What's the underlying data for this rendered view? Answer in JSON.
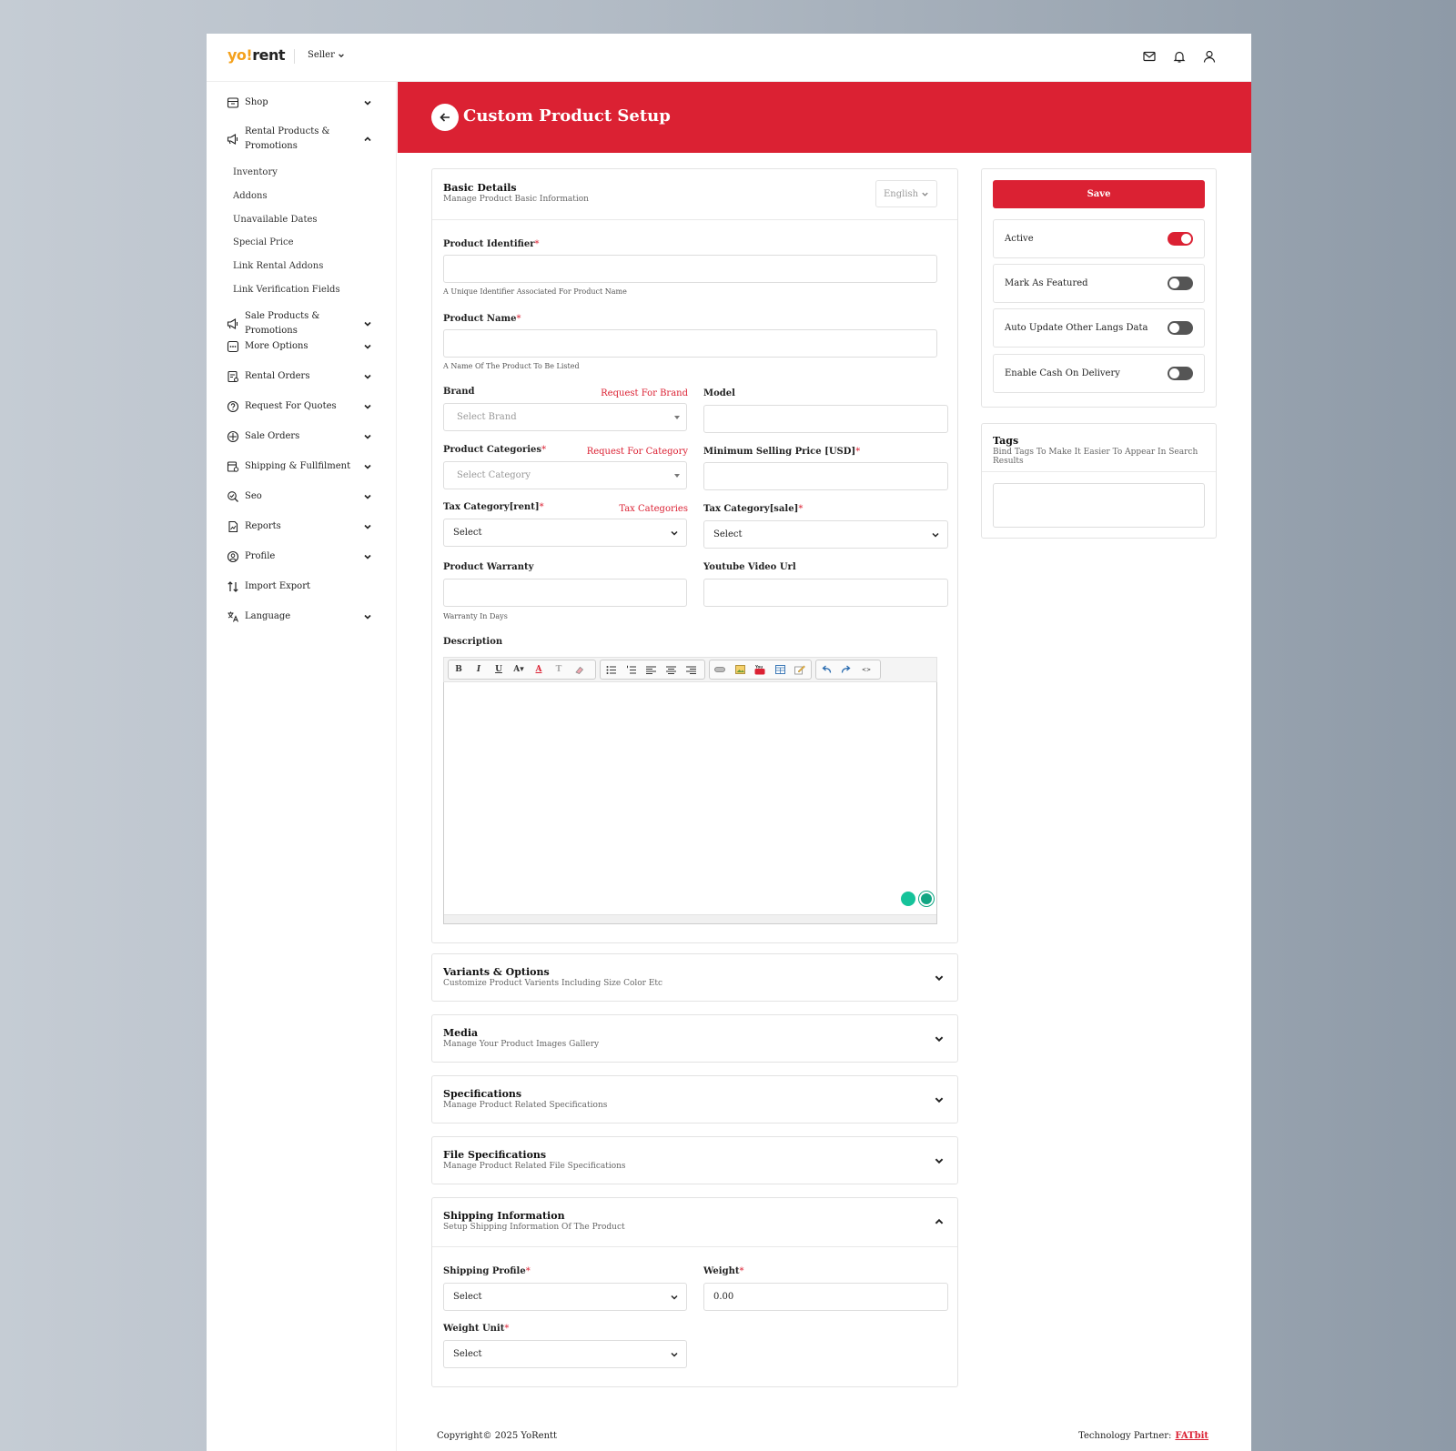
{
  "header": {
    "logo_prefix": "yo!",
    "logo_suffix": "rent",
    "role": "Seller"
  },
  "sidebar": {
    "items": [
      {
        "label": "Shop",
        "icon": "shop-icon"
      },
      {
        "label": "Rental Products & Promotions",
        "icon": "megaphone-icon"
      },
      {
        "label": "Sale Products & Promotions",
        "icon": "megaphone-icon"
      },
      {
        "label": "More Options",
        "icon": "more-icon"
      },
      {
        "label": "Rental Orders",
        "icon": "orders-icon"
      },
      {
        "label": "Request For Quotes",
        "icon": "question-icon"
      },
      {
        "label": "Sale Orders",
        "icon": "sale-icon"
      },
      {
        "label": "Shipping & Fullfilment",
        "icon": "shipping-icon"
      },
      {
        "label": "Seo",
        "icon": "seo-icon"
      },
      {
        "label": "Reports",
        "icon": "reports-icon"
      },
      {
        "label": "Profile",
        "icon": "profile-icon"
      },
      {
        "label": "Import Export",
        "icon": "import-export-icon"
      },
      {
        "label": "Language",
        "icon": "language-icon"
      }
    ],
    "sub_items": [
      "Inventory",
      "Addons",
      "Unavailable Dates",
      "Special Price",
      "Link Rental Addons",
      "Link Verification Fields"
    ]
  },
  "page": {
    "title": "Custom Product Setup"
  },
  "basic": {
    "title": "Basic Details",
    "subtitle": "Manage Product Basic Information",
    "language": "English",
    "product_identifier_label": "Product Identifier",
    "product_identifier_hint": "A Unique Identifier Associated For Product Name",
    "product_name_label": "Product Name",
    "product_name_hint": "A Name Of The Product To Be Listed",
    "brand_label": "Brand",
    "brand_link": "Request For Brand",
    "brand_placeholder": "Select Brand",
    "model_label": "Model",
    "categories_label": "Product Categories",
    "categories_link": "Request For Category",
    "categories_placeholder": "Select Category",
    "min_price_label": "Minimum Selling Price [USD]",
    "tax_rent_label": "Tax Category[rent]",
    "tax_link": "Tax Categories",
    "tax_rent_value": "Select",
    "tax_sale_label": "Tax Category[sale]",
    "tax_sale_value": "Select",
    "warranty_label": "Product Warranty",
    "warranty_hint": "Warranty In Days",
    "youtube_label": "Youtube Video Url",
    "description_label": "Description",
    "req_mark": "*"
  },
  "sections": [
    {
      "title": "Variants & Options",
      "subtitle": "Customize Product Varients Including Size Color Etc"
    },
    {
      "title": "Media",
      "subtitle": "Manage Your Product Images Gallery"
    },
    {
      "title": "Specifications",
      "subtitle": "Manage Product Related Specifications"
    },
    {
      "title": "File Specifications",
      "subtitle": "Manage Product Related File Specifications"
    }
  ],
  "shipping": {
    "title": "Shipping Information",
    "subtitle": "Setup Shipping Information Of The Product",
    "profile_label": "Shipping Profile",
    "profile_value": "Select",
    "weight_label": "Weight",
    "weight_value": "0.00",
    "unit_label": "Weight Unit",
    "unit_value": "Select"
  },
  "side": {
    "save_label": "Save",
    "toggles": [
      {
        "label": "Active",
        "on": true
      },
      {
        "label": "Mark As Featured",
        "on": false
      },
      {
        "label": "Auto Update Other Langs Data",
        "on": false
      },
      {
        "label": "Enable Cash On Delivery",
        "on": false
      }
    ],
    "tags_title": "Tags",
    "tags_subtitle": "Bind Tags To Make It Easier To Appear In Search Results"
  },
  "footer": {
    "copyright": "Copyright© 2025 YoRentt",
    "partner_label": "Technology Partner:",
    "partner_link": "FATbit"
  },
  "colors": {
    "accent": "#db2133",
    "logo_yo": "#f4a11c"
  }
}
